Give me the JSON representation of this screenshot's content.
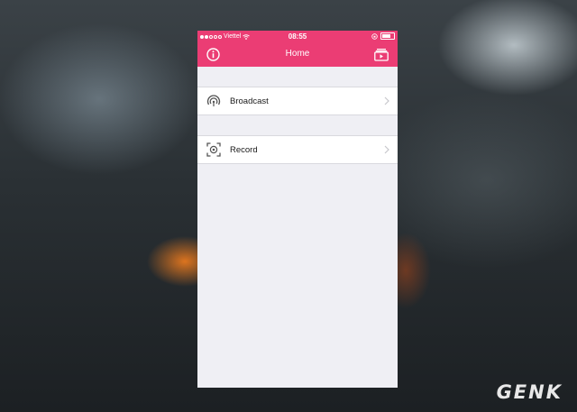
{
  "status_bar": {
    "carrier": "Viettel",
    "time": "08:55"
  },
  "nav": {
    "title": "Home",
    "left_icon": "info-icon",
    "right_icon": "media-library-icon"
  },
  "menu": [
    {
      "label": "Broadcast",
      "icon": "broadcast-icon"
    },
    {
      "label": "Record",
      "icon": "record-icon"
    }
  ],
  "colors": {
    "accent": "#eb3d74",
    "background": "#efeff4"
  },
  "watermark": "GENK"
}
